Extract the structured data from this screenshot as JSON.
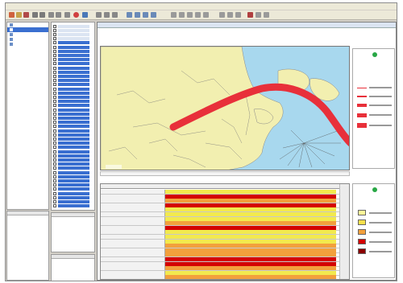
{
  "app": {
    "menu": [
      "",
      "",
      "",
      "",
      ""
    ],
    "window_title": ""
  },
  "map": {
    "title": "",
    "route_color": "#e8303a",
    "land_color": "#f2efb0",
    "water_color": "#a8d8ee"
  },
  "table": {
    "column_header": "",
    "row_colors": [
      "#f2e94e",
      "#d40000",
      "#f2a03c",
      "#d40000",
      "#f2e94e",
      "#f2e94e",
      "#f2e94e",
      "#f2a03c",
      "#d40000",
      "#f2e94e",
      "#f2e94e",
      "#f2e94e",
      "#f2a03c",
      "#f2a03c",
      "#f2a03c",
      "#d40000",
      "#d40000",
      "#f2a03c",
      "#f2e94e",
      "#f2a03c"
    ]
  },
  "legend_table": {
    "swatches": [
      "#fff799",
      "#f7e04c",
      "#f2a03c",
      "#d40000",
      "#8b0000"
    ]
  }
}
